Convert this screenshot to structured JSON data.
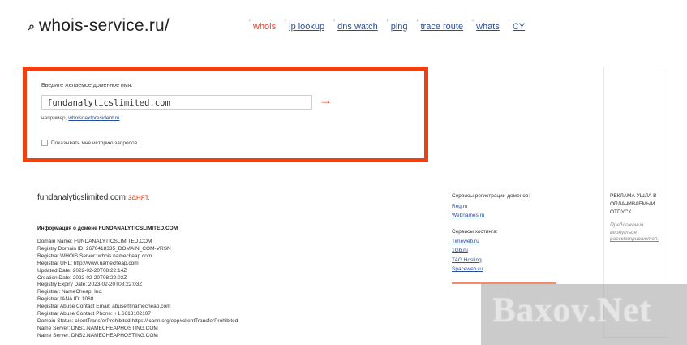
{
  "header": {
    "site_title": "whois-service.ru/",
    "nav": [
      {
        "label": "whois",
        "active": true
      },
      {
        "label": "ip lookup",
        "active": false
      },
      {
        "label": "dns watch",
        "active": false
      },
      {
        "label": "ping",
        "active": false
      },
      {
        "label": "trace route",
        "active": false
      },
      {
        "label": "whats",
        "active": false
      },
      {
        "label": "CY",
        "active": false
      }
    ]
  },
  "search": {
    "label": "Введите желаемое доменное имя:",
    "value": "fundanalyticslimited.com",
    "submit_icon": "→",
    "example_prefix": "например,",
    "example_link": "whoisnextpresident.ru",
    "history_label": "Показывать мне историю запросов",
    "history_checked": false
  },
  "result": {
    "domain": "fundanalyticslimited.com",
    "status": "занят.",
    "info_title": "Информация о домене FUNDANALYTICSLIMITED.COM",
    "lines": [
      "Domain Name: FUNDANALYTICSLIMITED.COM",
      "Registry Domain ID: 2676418335_DOMAIN_COM-VRSN",
      "Registrar WHOIS Server: whois.namecheap.com",
      "Registrar URL: http://www.namecheap.com",
      "Updated Date: 2022-02-20T08:22:14Z",
      "Creation Date: 2022-02-20T08:22:03Z",
      "Registry Expiry Date: 2023-02-20T08:22:03Z",
      "Registrar: NameCheap, Inc.",
      "Registrar IANA ID: 1068",
      "Registrar Abuse Contact Email: abuse@namecheap.com",
      "Registrar Abuse Contact Phone: +1.6613102107",
      "Domain Status: clientTransferProhibited https://icann.org/epp#clientTransferProhibited",
      "Name Server: DNS1.NAMECHEAPHOSTING.COM",
      "Name Server: DNS2.NAMECHEAPHOSTING.COM"
    ]
  },
  "sidebar": {
    "registrars_title": "Сервисы регистрации доменов:",
    "registrars": [
      "Reg.ru",
      "Webnames.ru"
    ],
    "hosting_title": "Сервисы хостинга:",
    "hosting": [
      "Timeweb.ru",
      "1Gb.ru",
      "TAG.Hosting",
      "Spaceweb.ru"
    ]
  },
  "ad": {
    "title": "РЕКЛАМА УШЛА В ОПЛАЧИВАЕМЫЙ ОТПУСК.",
    "note_prefix": "Предложения вернуться",
    "note_link": "рассматриваются."
  },
  "watermark": "Baxov.Net",
  "colors": {
    "accent": "#e8442a",
    "highlight_border": "#f0400f",
    "link": "#2a4d9b"
  }
}
